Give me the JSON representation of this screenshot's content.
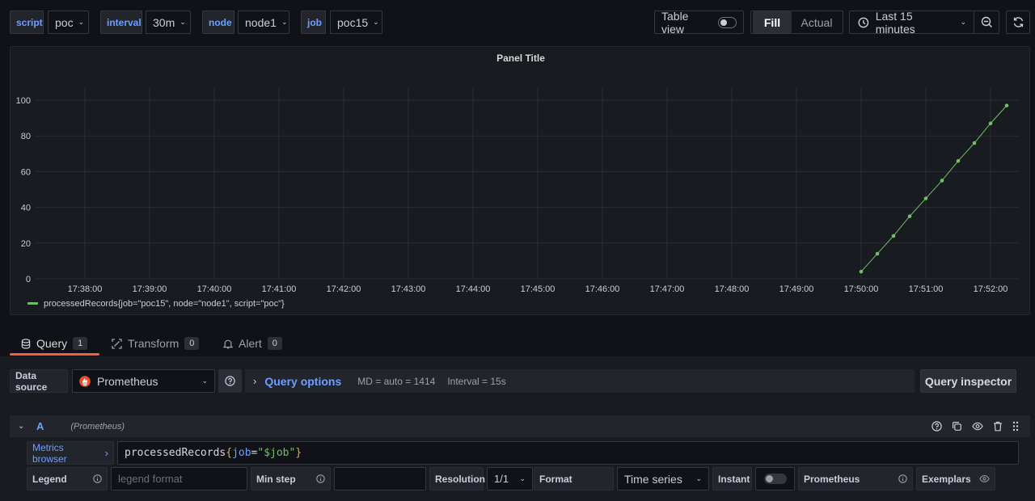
{
  "variables": [
    {
      "label": "script",
      "value": "poc"
    },
    {
      "label": "interval",
      "value": "30m"
    },
    {
      "label": "node",
      "value": "node1"
    },
    {
      "label": "job",
      "value": "poc15"
    }
  ],
  "toolbar": {
    "table_view_label": "Table view",
    "fill_label": "Fill",
    "actual_label": "Actual",
    "time_range": "Last 15 minutes"
  },
  "panel": {
    "title": "Panel Title"
  },
  "chart_data": {
    "type": "line",
    "title": "Panel Title",
    "xlabel": "",
    "ylabel": "",
    "ylim": [
      0,
      100
    ],
    "yticks": [
      "0",
      "20",
      "40",
      "60",
      "80",
      "100"
    ],
    "xticks": [
      "17:38:00",
      "17:39:00",
      "17:40:00",
      "17:41:00",
      "17:42:00",
      "17:43:00",
      "17:44:00",
      "17:45:00",
      "17:46:00",
      "17:47:00",
      "17:48:00",
      "17:49:00",
      "17:50:00",
      "17:51:00",
      "17:52:00"
    ],
    "grid": true,
    "legend_position": "bottom-left",
    "series": [
      {
        "name": "processedRecords{job=\"poc15\", node=\"node1\", script=\"poc\"}",
        "color": "#73bf69",
        "x": [
          "17:50:00",
          "17:50:15",
          "17:50:30",
          "17:50:45",
          "17:51:00",
          "17:51:15",
          "17:51:30",
          "17:51:45",
          "17:52:00",
          "17:52:15"
        ],
        "values": [
          4,
          14,
          24,
          35,
          45,
          55,
          66,
          76,
          87,
          97
        ]
      }
    ]
  },
  "query_tabs": [
    {
      "label": "Query",
      "count": "1"
    },
    {
      "label": "Transform",
      "count": "0"
    },
    {
      "label": "Alert",
      "count": "0"
    }
  ],
  "datasource": {
    "label": "Data source",
    "value": "Prometheus",
    "query_options_label": "Query options",
    "md": "MD = auto = 1414",
    "interval": "Interval = 15s",
    "inspector_label": "Query inspector"
  },
  "query": {
    "ref_id": "A",
    "ds_name": "(Prometheus)",
    "metrics_browser_label": "Metrics browser",
    "expr_metric": "processedRecords",
    "expr_open": "{",
    "expr_key": "job",
    "expr_eq": "=",
    "expr_val": "\"$job\"",
    "expr_close": "}"
  },
  "options": {
    "legend_label": "Legend",
    "legend_placeholder": "legend format",
    "min_step_label": "Min step",
    "resolution_label": "Resolution",
    "resolution_value": "1/1",
    "format_label": "Format",
    "format_value": "Time series",
    "instant_label": "Instant",
    "prometheus_label": "Prometheus",
    "exemplars_label": "Exemplars"
  },
  "colors": {
    "accent": "#6e9fff",
    "series": "#73bf69",
    "tab_active": "#f55f3e"
  }
}
